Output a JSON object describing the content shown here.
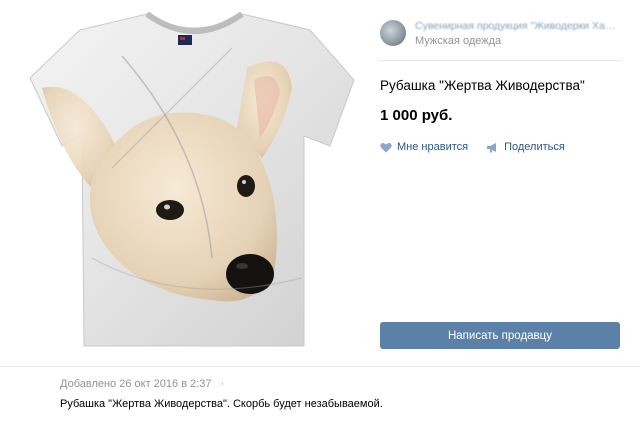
{
  "shop": {
    "name": "Сувенирная продукция \"Живодерки Хабар...",
    "category": "Мужская одежда"
  },
  "product": {
    "title": "Рубашка \"Жертва Живодерства\"",
    "price": "1 000 руб.",
    "image_icon": "tshirt-dog-print-image"
  },
  "actions": {
    "like_label": "Мне нравится",
    "share_label": "Поделиться",
    "like_icon": "heart-icon",
    "share_icon": "megaphone-icon"
  },
  "message_button_label": "Написать продавцу",
  "footer": {
    "added_text": "Добавлено 26 окт 2016 в 2:37",
    "separator": "·",
    "description": "Рубашка \"Жертва Живодерства\". Скорбь будет незабываемой."
  },
  "colors": {
    "link": "#2a5885",
    "button_bg": "#5b81a8",
    "muted": "#939393"
  }
}
